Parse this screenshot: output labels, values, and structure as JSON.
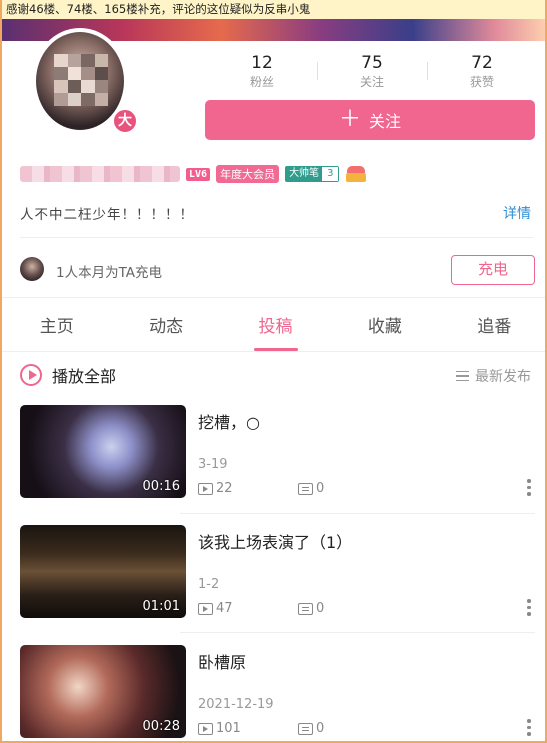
{
  "notice": "感谢46楼、74楼、165楼补充，评论的这位疑似为反串小鬼",
  "profile": {
    "level_badge": "LV6",
    "vip_label": "年度大会员",
    "medal_name": "大帅笔",
    "medal_level": "3",
    "avatar_badge": "大",
    "signature": "人不中二枉少年！！！！！",
    "detail_link": "详情"
  },
  "stats": [
    {
      "value": "12",
      "label": "粉丝"
    },
    {
      "value": "75",
      "label": "关注"
    },
    {
      "value": "72",
      "label": "获赞"
    }
  ],
  "follow_button": {
    "icon": "plus-icon",
    "label": "关注"
  },
  "charge": {
    "text": "1人本月为TA充电",
    "button": "充电"
  },
  "tabs": [
    {
      "label": "主页",
      "active": false
    },
    {
      "label": "动态",
      "active": false
    },
    {
      "label": "投稿",
      "active": true
    },
    {
      "label": "收藏",
      "active": false
    },
    {
      "label": "追番",
      "active": false
    }
  ],
  "list_header": {
    "play_all": "播放全部",
    "sort_label": "最新发布"
  },
  "videos": [
    {
      "title": "挖槽，○",
      "date": "3-19",
      "duration": "00:16",
      "plays": "22",
      "comments": "0"
    },
    {
      "title": "该我上场表演了（1）",
      "date": "1-2",
      "duration": "01:01",
      "plays": "47",
      "comments": "0"
    },
    {
      "title": "卧槽原",
      "date": "2021-12-19",
      "duration": "00:28",
      "plays": "101",
      "comments": "0"
    }
  ],
  "colors": {
    "accent": "#f0668f",
    "link": "#2d8ed6",
    "medal": "#2f9c8e",
    "notice_bg": "#fff4c8"
  }
}
